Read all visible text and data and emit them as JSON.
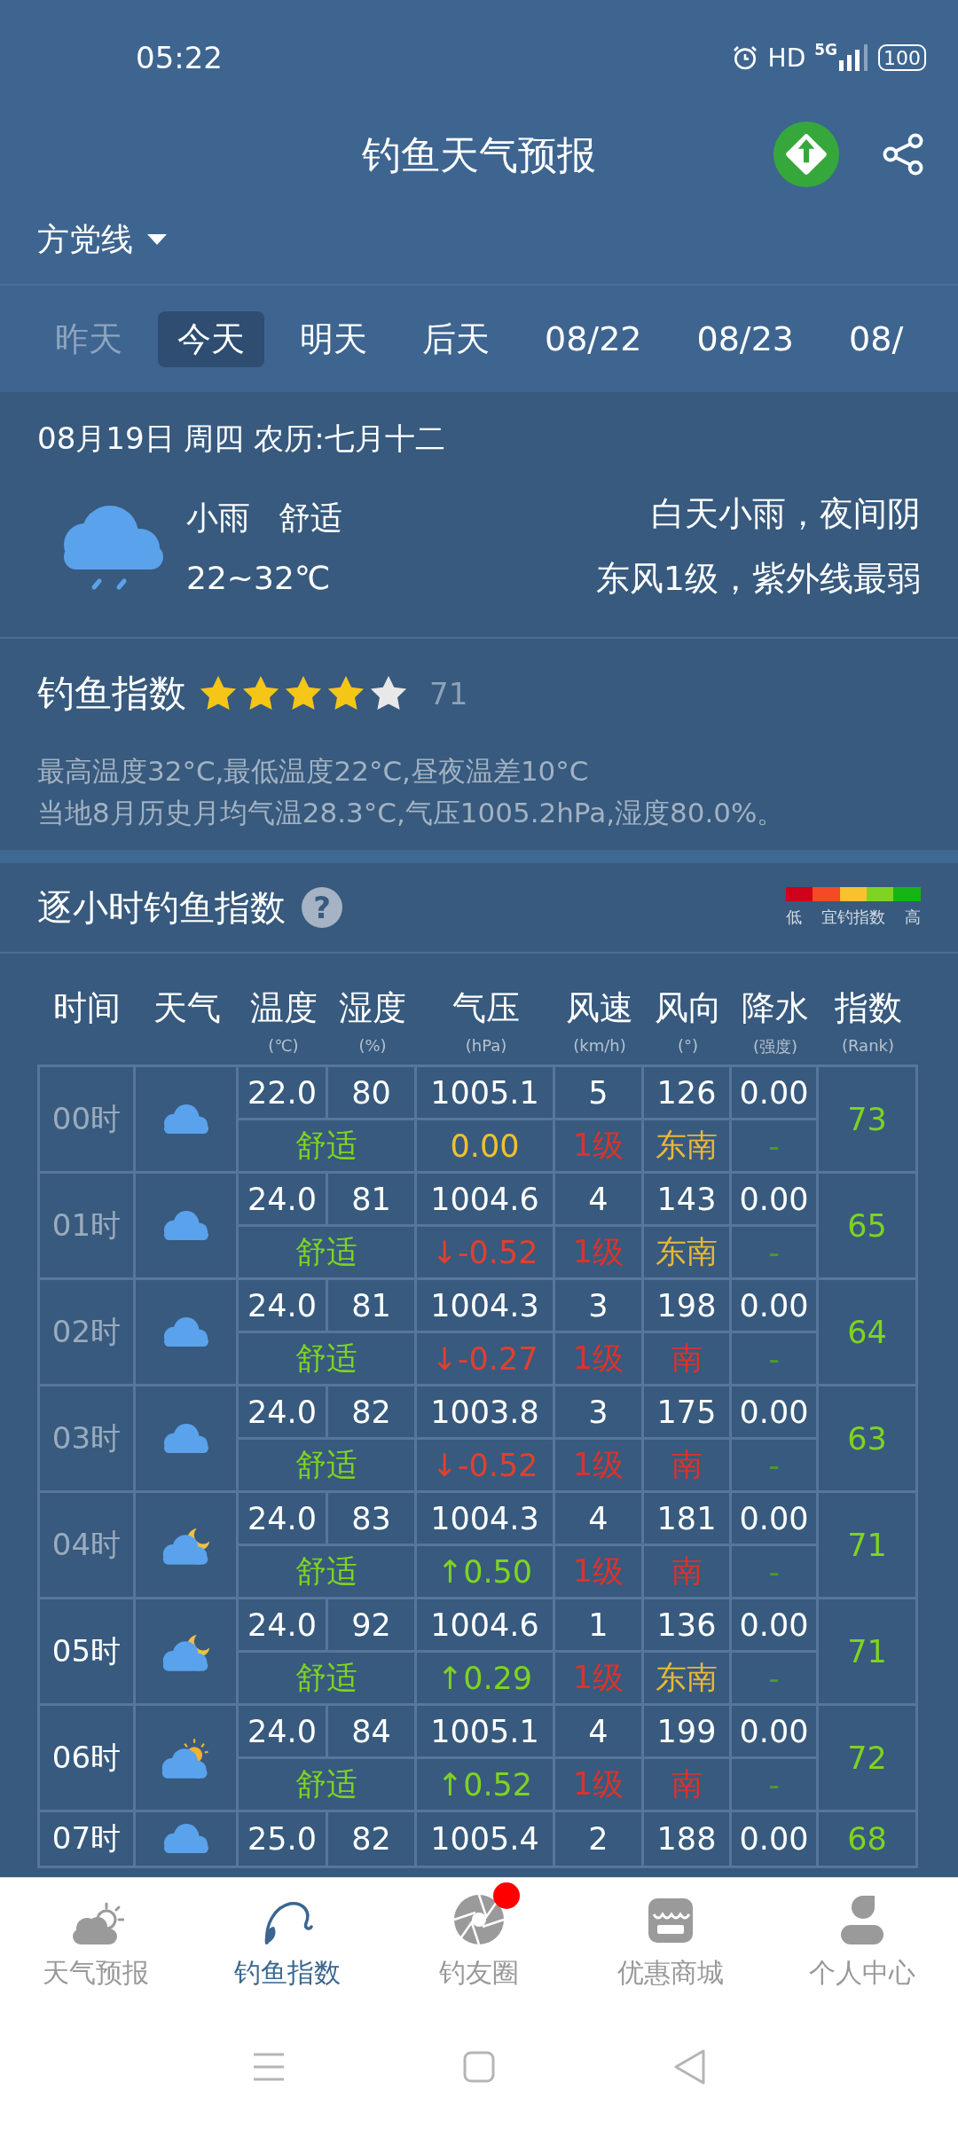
{
  "status_bar": {
    "time": "05:22",
    "hd": "HD",
    "network": "5G",
    "battery": "100"
  },
  "header": {
    "title": "钓鱼天气预报",
    "location": "方党线"
  },
  "day_tabs": [
    {
      "label": "昨天",
      "selected": false,
      "disabled": true
    },
    {
      "label": "今天",
      "selected": true,
      "disabled": false
    },
    {
      "label": "明天",
      "selected": false,
      "disabled": false
    },
    {
      "label": "后天",
      "selected": false,
      "disabled": false
    },
    {
      "label": "08/22",
      "selected": false,
      "disabled": false
    },
    {
      "label": "08/23",
      "selected": false,
      "disabled": false
    },
    {
      "label": "08/",
      "selected": false,
      "disabled": false
    }
  ],
  "today": {
    "date": "08月19日 周四 农历:七月十二",
    "condition": "小雨",
    "comfort": "舒适",
    "temp_range": "22~32℃",
    "summary": "白天小雨，夜间阴",
    "wind_uv": "东风1级，紫外线最弱"
  },
  "fishing_index": {
    "title": "钓鱼指数",
    "stars": 4,
    "score": "71",
    "details": [
      "最高温度32°C,最低温度22°C,昼夜温差10°C",
      "当地8月历史月均气温28.3°C,气压1005.2hPa,湿度80.0%。"
    ]
  },
  "hourly": {
    "title": "逐小时钓鱼指数",
    "help": "?",
    "legend": {
      "low": "低",
      "middle": "宜钓指数",
      "high": "高"
    },
    "columns": [
      {
        "label": "时间"
      },
      {
        "label": "天气"
      },
      {
        "label": "温度",
        "unit": "(℃)"
      },
      {
        "label": "湿度",
        "unit": "(%)"
      },
      {
        "label": "气压",
        "unit": "(hPa)"
      },
      {
        "label": "风速",
        "unit": "(km/h)"
      },
      {
        "label": "风向",
        "unit": "(°)"
      },
      {
        "label": "降水",
        "unit": "(强度)"
      },
      {
        "label": "指数",
        "unit": "(Rank)"
      }
    ],
    "rows": [
      {
        "hour": "00时",
        "past": true,
        "weather": {
          "kind": "cloudy"
        },
        "temp": "22.0",
        "humidity": "80",
        "pressure": "1005.1",
        "wind_speed": "5",
        "wind_deg": "126",
        "precip": "0.00",
        "comfort": "舒适",
        "pressure_change": {
          "text": "0.00",
          "color": "#f0c030"
        },
        "wind_level": "1级",
        "direction": {
          "text": "东南",
          "color": "#e8b838"
        },
        "precip_level": "-",
        "index": "73"
      },
      {
        "hour": "01时",
        "past": true,
        "weather": {
          "kind": "cloudy"
        },
        "temp": "24.0",
        "humidity": "81",
        "pressure": "1004.6",
        "wind_speed": "4",
        "wind_deg": "143",
        "precip": "0.00",
        "comfort": "舒适",
        "pressure_change": {
          "text": "↓-0.52",
          "color": "#e0402f"
        },
        "wind_level": "1级",
        "direction": {
          "text": "东南",
          "color": "#e8b838"
        },
        "precip_level": "-",
        "index": "65"
      },
      {
        "hour": "02时",
        "past": true,
        "weather": {
          "kind": "cloudy"
        },
        "temp": "24.0",
        "humidity": "81",
        "pressure": "1004.3",
        "wind_speed": "3",
        "wind_deg": "198",
        "precip": "0.00",
        "comfort": "舒适",
        "pressure_change": {
          "text": "↓-0.27",
          "color": "#e0402f"
        },
        "wind_level": "1级",
        "direction": {
          "text": "南",
          "color": "#d8342c"
        },
        "precip_level": "-",
        "index": "64"
      },
      {
        "hour": "03时",
        "past": true,
        "weather": {
          "kind": "cloudy"
        },
        "temp": "24.0",
        "humidity": "82",
        "pressure": "1003.8",
        "wind_speed": "3",
        "wind_deg": "175",
        "precip": "0.00",
        "comfort": "舒适",
        "pressure_change": {
          "text": "↓-0.52",
          "color": "#e0402f"
        },
        "wind_level": "1级",
        "direction": {
          "text": "南",
          "color": "#d8342c"
        },
        "precip_level": "-",
        "index": "63"
      },
      {
        "hour": "04时",
        "past": true,
        "weather": {
          "kind": "cloudy-night"
        },
        "temp": "24.0",
        "humidity": "83",
        "pressure": "1004.3",
        "wind_speed": "4",
        "wind_deg": "181",
        "precip": "0.00",
        "comfort": "舒适",
        "pressure_change": {
          "text": "↑0.50",
          "color": "#7ed321"
        },
        "wind_level": "1级",
        "direction": {
          "text": "南",
          "color": "#d8342c"
        },
        "precip_level": "-",
        "index": "71"
      },
      {
        "hour": "05时",
        "past": false,
        "weather": {
          "kind": "cloudy-night"
        },
        "temp": "24.0",
        "humidity": "92",
        "pressure": "1004.6",
        "wind_speed": "1",
        "wind_deg": "136",
        "precip": "0.00",
        "comfort": "舒适",
        "pressure_change": {
          "text": "↑0.29",
          "color": "#7ed321"
        },
        "wind_level": "1级",
        "direction": {
          "text": "东南",
          "color": "#e8b838"
        },
        "precip_level": "-",
        "index": "71"
      },
      {
        "hour": "06时",
        "past": false,
        "weather": {
          "kind": "cloudy-day"
        },
        "temp": "24.0",
        "humidity": "84",
        "pressure": "1005.1",
        "wind_speed": "4",
        "wind_deg": "199",
        "precip": "0.00",
        "comfort": "舒适",
        "pressure_change": {
          "text": "↑0.52",
          "color": "#7ed321"
        },
        "wind_level": "1级",
        "direction": {
          "text": "南",
          "color": "#d8342c"
        },
        "precip_level": "-",
        "index": "72"
      },
      {
        "hour": "07时",
        "past": false,
        "weather": {
          "kind": "cloudy"
        },
        "temp": "25.0",
        "humidity": "82",
        "pressure": "1005.4",
        "wind_speed": "2",
        "wind_deg": "188",
        "precip": "0.00",
        "index": "68"
      }
    ]
  },
  "bottom_nav": [
    {
      "label": "天气预报",
      "kind": "weather",
      "selected": false,
      "badge": false
    },
    {
      "label": "钓鱼指数",
      "kind": "fishing",
      "selected": true,
      "badge": false
    },
    {
      "label": "钓友圈",
      "kind": "circle",
      "selected": false,
      "badge": true
    },
    {
      "label": "优惠商城",
      "kind": "shop",
      "selected": false,
      "badge": false
    },
    {
      "label": "个人中心",
      "kind": "profile",
      "selected": false,
      "badge": false
    }
  ]
}
